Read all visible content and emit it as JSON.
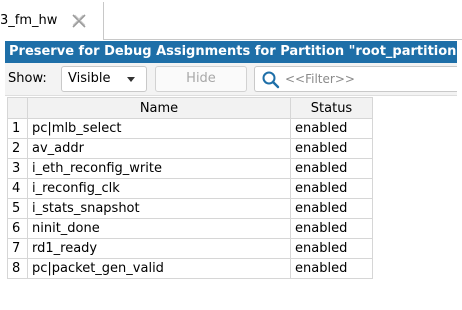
{
  "tab": {
    "label": "3_fm_hw",
    "close_icon": "close-icon"
  },
  "panel": {
    "title": "Preserve for Debug Assignments for Partition \"root_partition\"",
    "title_bg": "#1e6fa8"
  },
  "toolbar": {
    "show_label": "Show:",
    "show_value": "Visible",
    "hide_label": "Hide",
    "filter_placeholder": "<<Filter>>"
  },
  "table": {
    "columns": [
      "",
      "Name",
      "Status"
    ],
    "rows": [
      {
        "num": "1",
        "name": "pc|mlb_select",
        "status": "enabled"
      },
      {
        "num": "2",
        "name": "av_addr",
        "status": "enabled"
      },
      {
        "num": "3",
        "name": "i_eth_reconfig_write",
        "status": "enabled"
      },
      {
        "num": "4",
        "name": "i_reconfig_clk",
        "status": "enabled"
      },
      {
        "num": "5",
        "name": "i_stats_snapshot",
        "status": "enabled"
      },
      {
        "num": "6",
        "name": "ninit_done",
        "status": "enabled"
      },
      {
        "num": "7",
        "name": "rd1_ready",
        "status": "enabled"
      },
      {
        "num": "8",
        "name": "pc|packet_gen_valid",
        "status": "enabled"
      }
    ]
  }
}
